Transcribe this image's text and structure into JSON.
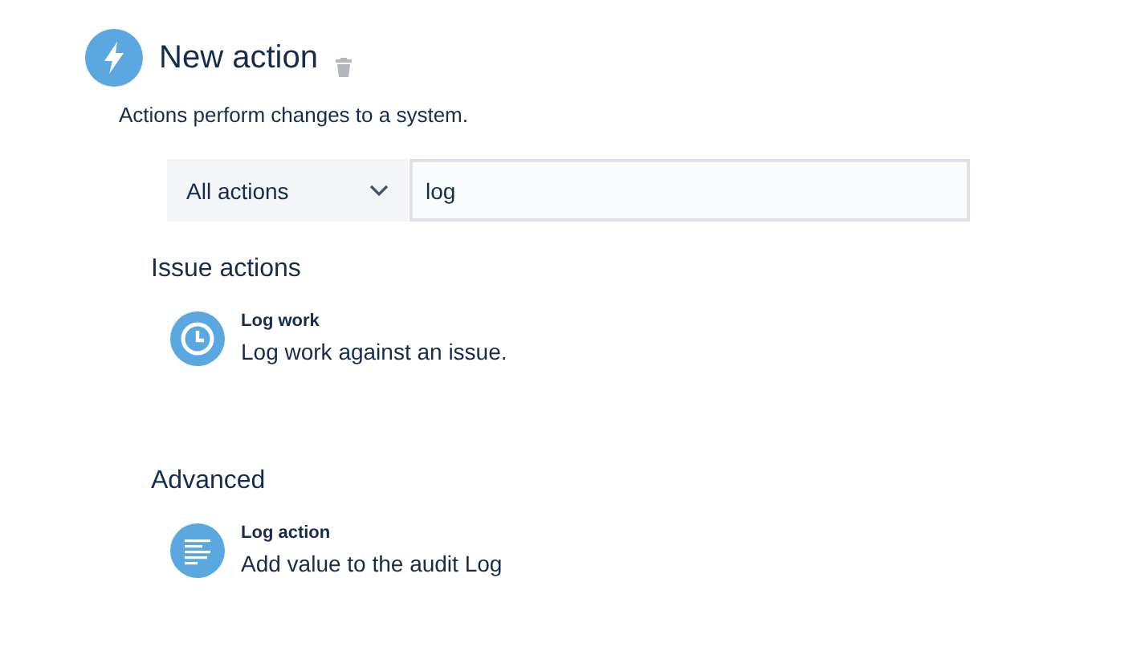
{
  "header": {
    "title": "New action",
    "description": "Actions perform changes to a system."
  },
  "filter": {
    "dropdown": "All actions",
    "search_value": "log"
  },
  "groups": [
    {
      "heading": "Issue actions",
      "items": [
        {
          "kind": "clock",
          "title": "Log work",
          "description": "Log work against an issue."
        }
      ]
    },
    {
      "heading": "Advanced",
      "items": [
        {
          "kind": "list",
          "title": "Log action",
          "description": "Add value to the audit Log"
        }
      ]
    }
  ]
}
